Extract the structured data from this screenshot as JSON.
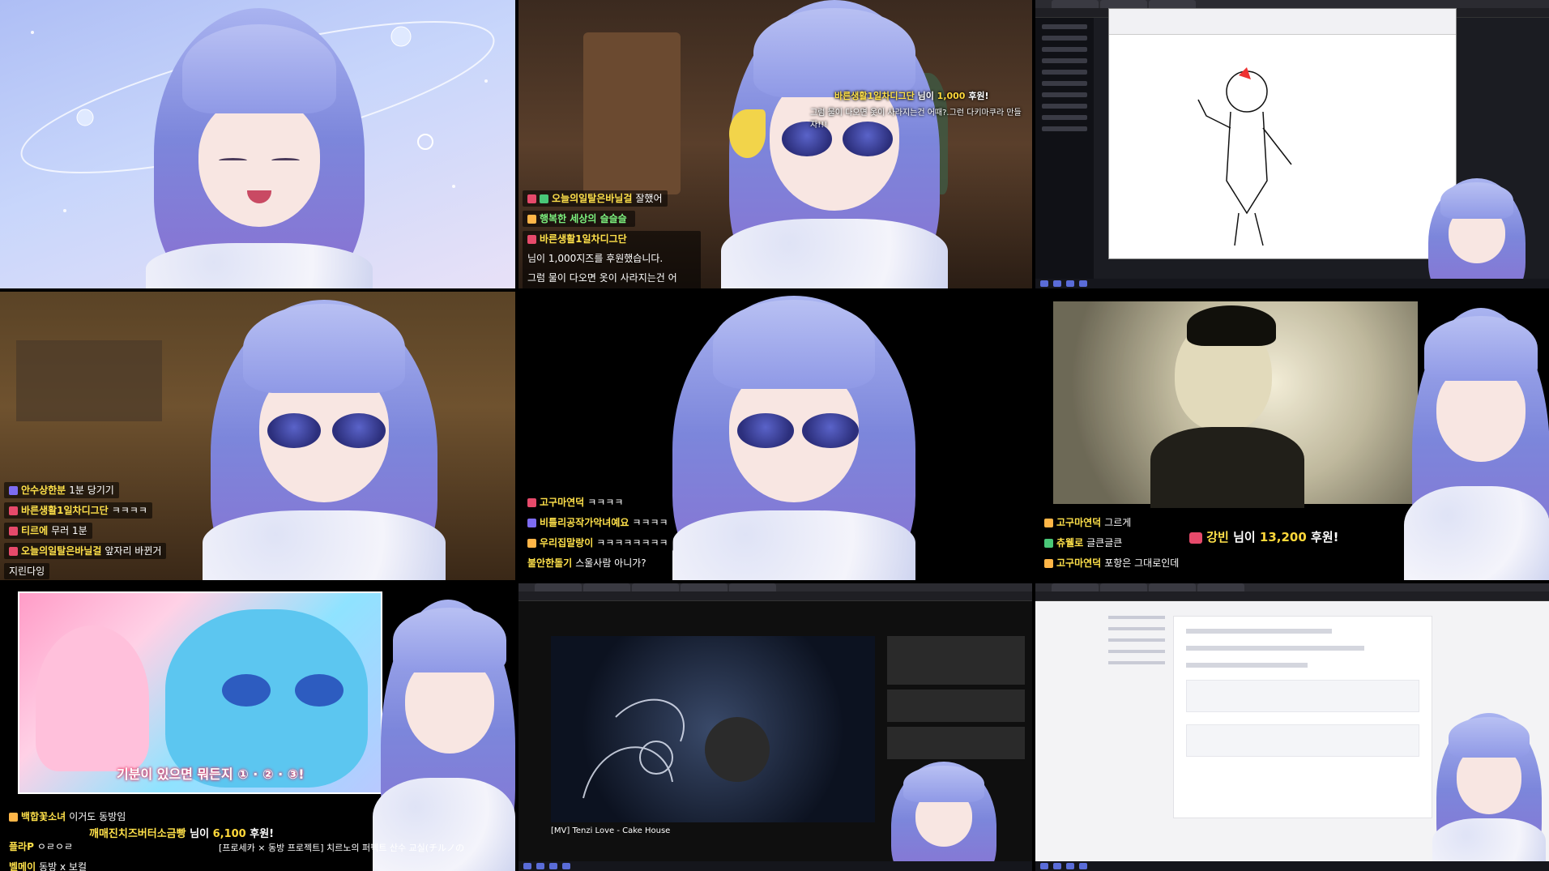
{
  "tiles": {
    "t2": {
      "donation": {
        "name": "바른생활1일차디그단",
        "suffix": "님이",
        "amount": "1,000",
        "unit": "후원!"
      },
      "donation_msg": "그럼 물이 다오면 옷이 사라지는건 어때?.그런 다키마쿠라 만들자!!!",
      "chat": [
        {
          "nick": "오늘의일탈은바닐걸",
          "text": "잘했어"
        },
        {
          "nick": "행복한 세상의 슬슬슬",
          "text": ""
        },
        {
          "nick": "바른생활1일차디그단",
          "text": "님이 1,000지즈를 후원했습니다."
        }
      ],
      "chat_msg": "그럼 물이 다오면 옷이 사라지는건 어때?.그런 다키마쿠라 만들자!!!"
    },
    "t4": {
      "chat": [
        {
          "nick": "안수상한분",
          "text": "1분 당기기"
        },
        {
          "nick": "바른생활1일차디그단",
          "text": "ㅋㅋㅋㅋ"
        },
        {
          "nick": "티르에",
          "text": "무러 1분"
        },
        {
          "nick": "오늘의일탈은바닐걸",
          "text": "앞자리 바뀐거"
        }
      ],
      "chat_tail": "지린다잉"
    },
    "t5": {
      "chat": [
        {
          "nick": "고구마연덕",
          "text": "ㅋㅋㅋㅋ"
        },
        {
          "nick": "비틀리공작가악녀예요",
          "text": "ㅋㅋㅋㅋ"
        },
        {
          "nick": "우리집말랑이",
          "text": "ㅋㅋㅋㅋㅋㅋㅋㅋ"
        },
        {
          "nick": "불안한돌기",
          "text": "스울사람 아니가?"
        }
      ]
    },
    "t6": {
      "chat": [
        {
          "nick": "고구마연덕",
          "text": "그르게"
        },
        {
          "nick": "츄웰로",
          "text": "글큰글큰"
        },
        {
          "nick": "고구마연덕",
          "text": "포항은 그대로인데"
        }
      ],
      "donation": {
        "name": "강빈",
        "suffix": "님이",
        "amount": "13,200",
        "unit": "후원!"
      }
    },
    "t7": {
      "caption": "기분이 있으면 뭐든지 ① · ② · ③!",
      "chat": [
        {
          "nick": "백합꽃소녀",
          "text": "이거도 동방임"
        },
        {
          "nick": "플라P",
          "text": "ㅇㄹㅇㄹ"
        },
        {
          "nick": "벨메이",
          "text": "동방 x 보컬"
        }
      ],
      "donation": {
        "name": "깨매진치즈버터소금빵",
        "suffix": "님이",
        "amount": "6,100",
        "unit": "후원!"
      },
      "ticker": "[프로세카 × 동방 프로젝트] 치르노의 퍼펙트 산수 교실(チルノの"
    },
    "t8": {
      "video_title": "[MV] Tenzi Love - Cake House"
    }
  },
  "colors": {
    "accent": "#ffd83a",
    "hair": "#8f99e6",
    "bg_dark": "#000000"
  }
}
